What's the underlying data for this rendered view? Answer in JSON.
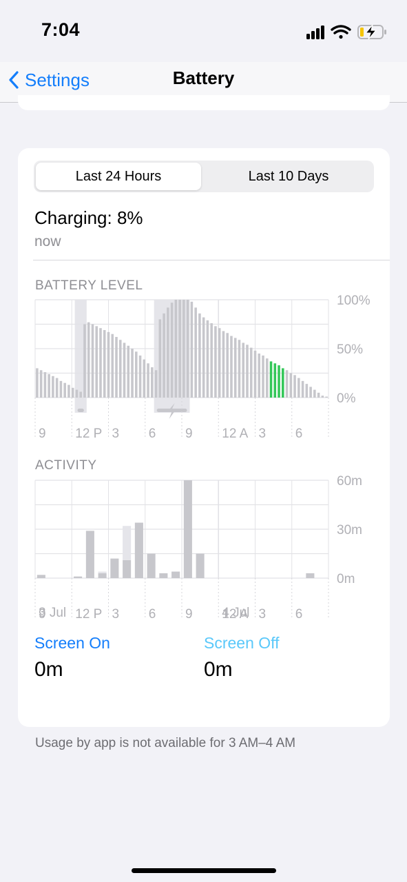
{
  "status_bar": {
    "time": "7:04",
    "icons": [
      "cellular-signal-icon",
      "wifi-icon",
      "battery-charging-icon"
    ]
  },
  "nav": {
    "back_label": "Settings",
    "title": "Battery"
  },
  "segment": {
    "active": "Last 24 Hours",
    "inactive": "Last 10 Days"
  },
  "charging": {
    "status": "Charging: 8%",
    "time": "now"
  },
  "battery_section": {
    "title": "BATTERY LEVEL"
  },
  "activity_section": {
    "title": "ACTIVITY"
  },
  "chart_data": [
    {
      "type": "bar",
      "title": "BATTERY LEVEL",
      "x_tick_labels": [
        "9",
        "12 P",
        "3",
        "6",
        "9",
        "12 A",
        "3",
        "6"
      ],
      "y_tick_labels": [
        "100%",
        "50%",
        "0%"
      ],
      "ylim": [
        0,
        100
      ],
      "unit": "%",
      "hours": 8,
      "values": [
        30,
        28,
        26,
        24,
        22,
        20,
        17,
        15,
        13,
        10,
        8,
        6,
        75,
        77,
        75,
        73,
        71,
        69,
        67,
        65,
        62,
        59,
        56,
        53,
        50,
        47,
        43,
        39,
        35,
        31,
        28,
        80,
        86,
        92,
        97,
        100,
        100,
        100,
        100,
        98,
        92,
        86,
        82,
        79,
        76,
        73,
        71,
        68,
        66,
        63,
        61,
        59,
        56,
        54,
        51,
        48,
        45,
        43,
        40,
        37,
        35,
        33,
        30,
        28,
        25,
        23,
        20,
        17,
        14,
        11,
        8,
        5,
        2,
        1
      ],
      "charging_spans": [
        [
          10,
          13
        ],
        [
          30,
          39
        ]
      ],
      "current_indices": [
        59,
        60,
        61,
        62
      ],
      "colors": {
        "bar": "#c7c7cc",
        "charging_band": "#e5e5ea",
        "current": "#34c759"
      }
    },
    {
      "type": "bar",
      "title": "ACTIVITY",
      "x_tick_labels": [
        "9",
        "12 P",
        "3",
        "6",
        "9",
        "12 A",
        "3",
        "6"
      ],
      "category_labels": [
        "3 Jul",
        "4 Jul"
      ],
      "y_tick_labels": [
        "60m",
        "30m",
        "0m"
      ],
      "ylim": [
        0,
        60
      ],
      "unit": "minutes",
      "hours": 8,
      "series": [
        {
          "name": "Screen On",
          "values": [
            2,
            0,
            0,
            1,
            29,
            3,
            12,
            11,
            34,
            15,
            3,
            4,
            60,
            15,
            0,
            0,
            0,
            0,
            0,
            0,
            0,
            0,
            3
          ]
        },
        {
          "name": "Screen Off",
          "values": [
            0,
            0,
            0,
            0,
            0,
            1,
            0,
            21,
            0,
            0,
            0,
            0,
            0,
            0,
            0,
            0,
            0,
            0,
            0,
            0,
            0,
            0,
            0
          ]
        }
      ],
      "colors": {
        "screen_on": "#c7c7cc",
        "screen_off": "#e5e5ea"
      }
    }
  ],
  "legend": {
    "screen_on": {
      "label": "Screen On",
      "value": "0m",
      "color": "#147efb"
    },
    "screen_off": {
      "label": "Screen Off",
      "value": "0m",
      "color": "#5ac8fa"
    }
  },
  "footnote": "Usage by app is not available for 3 AM–4 AM"
}
